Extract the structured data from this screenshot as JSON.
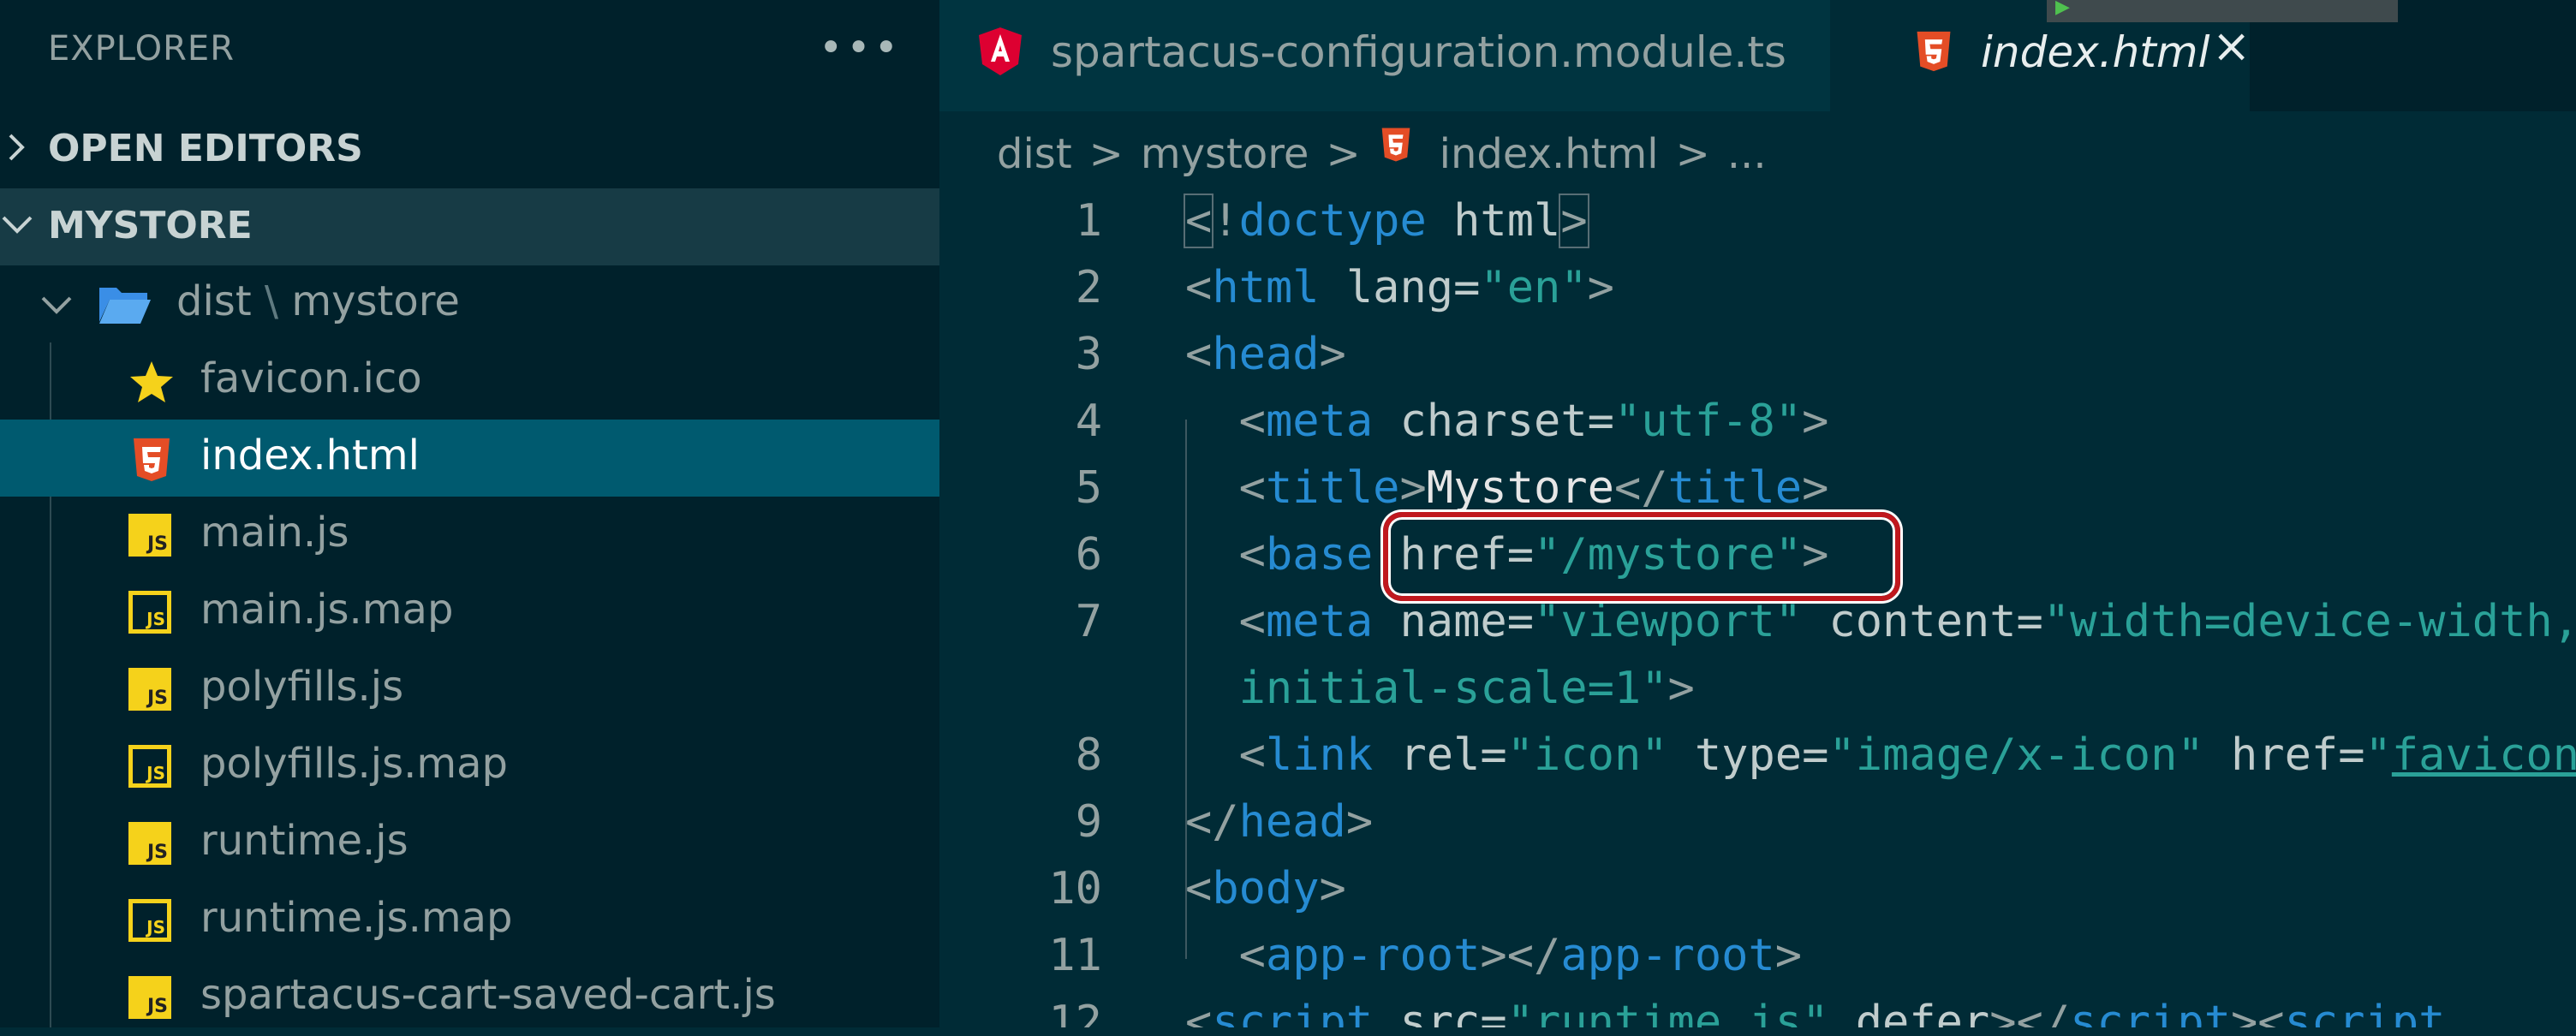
{
  "sidebar": {
    "title": "EXPLORER",
    "more_icon": "ellipsis-icon",
    "sections": [
      {
        "label": "OPEN EDITORS",
        "expanded": false
      },
      {
        "label": "MYSTORE",
        "expanded": true
      }
    ],
    "folder": {
      "path": "dist",
      "separator": "\\",
      "name": "mystore",
      "icon": "folder-open-icon"
    },
    "files": [
      {
        "name": "favicon.ico",
        "icon": "star-icon"
      },
      {
        "name": "index.html",
        "icon": "html5-icon",
        "selected": true
      },
      {
        "name": "main.js",
        "icon": "js-icon"
      },
      {
        "name": "main.js.map",
        "icon": "js-map-icon"
      },
      {
        "name": "polyfills.js",
        "icon": "js-icon"
      },
      {
        "name": "polyfills.js.map",
        "icon": "js-map-icon"
      },
      {
        "name": "runtime.js",
        "icon": "js-icon"
      },
      {
        "name": "runtime.js.map",
        "icon": "js-map-icon"
      },
      {
        "name": "spartacus-cart-saved-cart.js",
        "icon": "js-icon"
      }
    ],
    "js_badge": "JS"
  },
  "tabs": [
    {
      "label": "spartacus-configuration.module.ts",
      "icon": "angular-icon",
      "active": false
    },
    {
      "label": "index.html",
      "icon": "html5-icon",
      "active": true,
      "close": "×"
    }
  ],
  "breadcrumb": {
    "items": [
      "dist",
      "mystore",
      "index.html",
      "..."
    ],
    "separator": ">"
  },
  "editor": {
    "line_numbers": [
      "1",
      "2",
      "3",
      "4",
      "5",
      "6",
      "7",
      "",
      "8",
      "9",
      "10",
      "11",
      "12"
    ],
    "highlight_text": "href=\"/mystore\""
  },
  "colors": {
    "background": "#002b36",
    "sidebar": "#00212b",
    "selection": "#005a6f",
    "tag": "#268bd2",
    "string": "#2aa198",
    "highlight_border": "#c0181e"
  }
}
